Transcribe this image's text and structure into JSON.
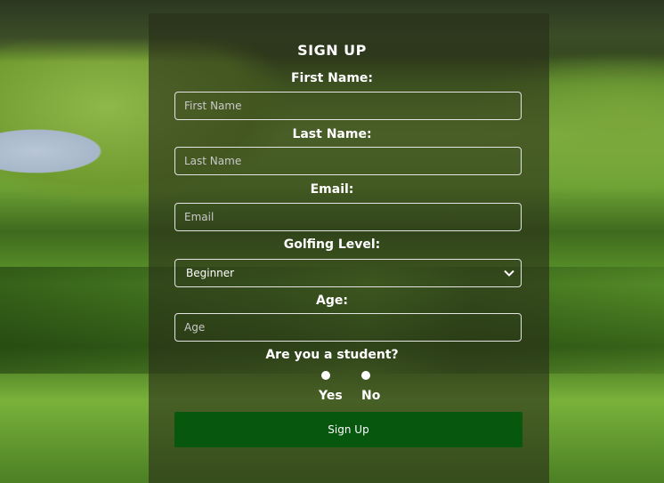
{
  "form": {
    "title": "SIGN UP",
    "first_name": {
      "label": "First Name:",
      "placeholder": "First Name"
    },
    "last_name": {
      "label": "Last Name:",
      "placeholder": "Last Name"
    },
    "email": {
      "label": "Email:",
      "placeholder": "Email"
    },
    "golf_level": {
      "label": "Golfing Level:",
      "selected": "Beginner"
    },
    "age": {
      "label": "Age:",
      "placeholder": "Age"
    },
    "student": {
      "label": "Are you a student?",
      "yes": "Yes",
      "no": "No"
    },
    "submit_label": "Sign Up"
  },
  "colors": {
    "submit_bg": "#07570f",
    "panel_overlay": "rgba(40,45,25,0.62)"
  }
}
